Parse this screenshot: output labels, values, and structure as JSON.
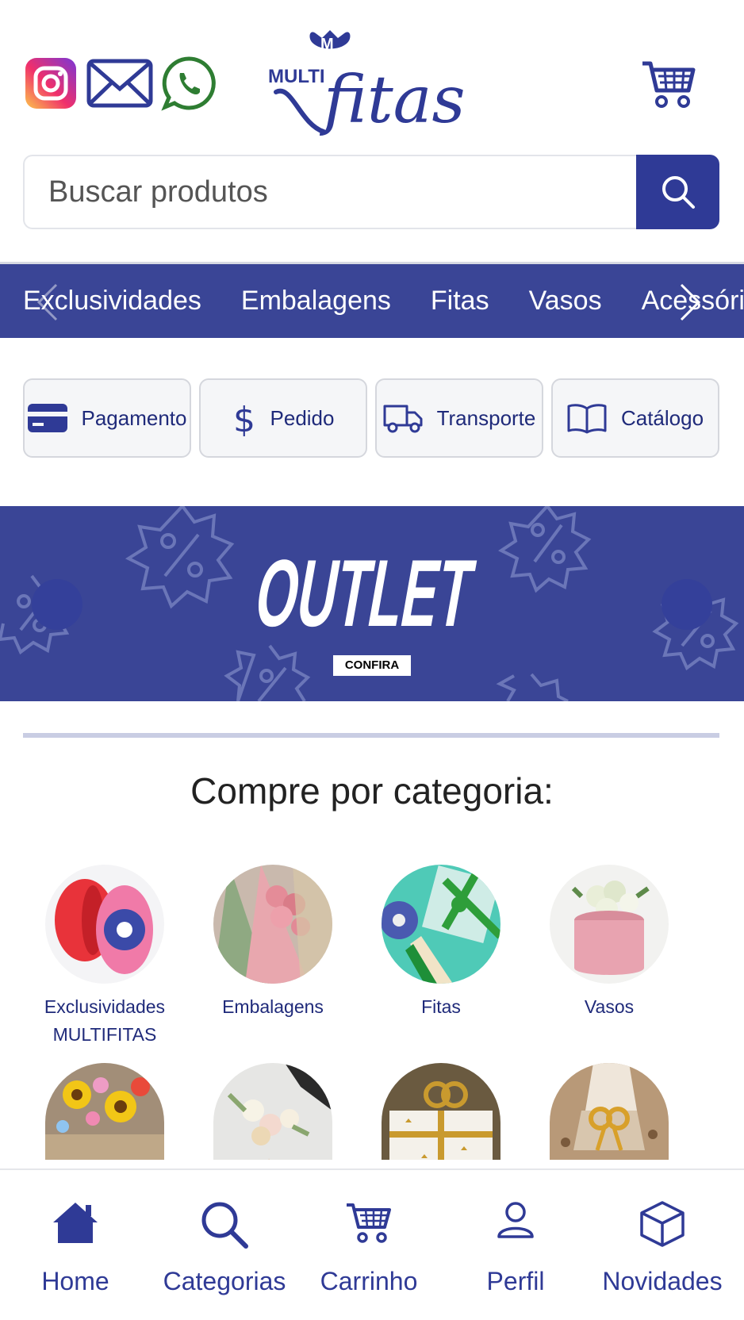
{
  "brand": {
    "logo_text_top": "MULTI",
    "logo_text_script": "fitas",
    "primary_color": "#3a4596",
    "accent_color": "#2f3a96"
  },
  "header": {
    "social": [
      {
        "name": "instagram-icon"
      },
      {
        "name": "email-icon"
      },
      {
        "name": "whatsapp-icon"
      }
    ]
  },
  "search": {
    "placeholder": "Buscar produtos"
  },
  "category_bar": {
    "items": [
      "Exclusividades",
      "Embalagens",
      "Fitas",
      "Vasos",
      "Acessórios"
    ]
  },
  "info_buttons": [
    {
      "label": "Pagamento",
      "icon": "card-icon"
    },
    {
      "label": "Pedido",
      "icon": "dollar-icon"
    },
    {
      "label": "Transporte",
      "icon": "truck-icon"
    },
    {
      "label": "Catálogo",
      "icon": "book-icon"
    }
  ],
  "banner": {
    "title": "OUTLET",
    "cta": "CONFIRA"
  },
  "categories_section": {
    "title": "Compre por categoria:",
    "items": [
      {
        "label": "Exclusividades MULTIFITAS"
      },
      {
        "label": "Embalagens"
      },
      {
        "label": "Fitas"
      },
      {
        "label": "Vasos"
      },
      {
        "label": ""
      },
      {
        "label": ""
      },
      {
        "label": ""
      },
      {
        "label": ""
      }
    ]
  },
  "bottom_nav": [
    {
      "label": "Home",
      "icon": "home-icon"
    },
    {
      "label": "Categorias",
      "icon": "search-icon"
    },
    {
      "label": "Carrinho",
      "icon": "cart-icon"
    },
    {
      "label": "Perfil",
      "icon": "user-icon"
    },
    {
      "label": "Novidades",
      "icon": "box-icon"
    }
  ]
}
